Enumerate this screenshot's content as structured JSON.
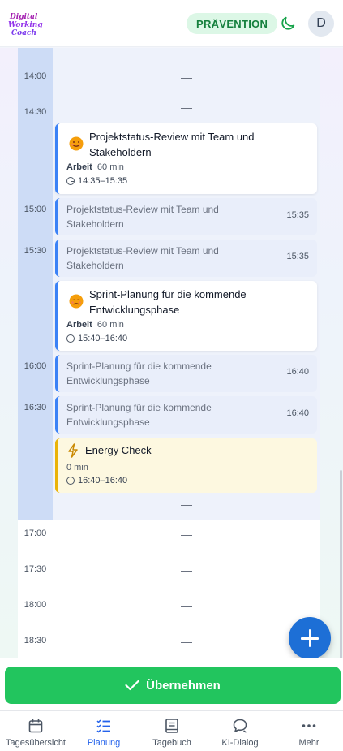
{
  "header": {
    "logo_text": "Digital Working Coach",
    "badge": "PRÄVENTION",
    "avatar_initial": "D",
    "colors": {
      "badge_bg": "#dcf7e6",
      "badge_text": "#15803d"
    }
  },
  "timeline": {
    "labels": [
      "14:00",
      "14:30",
      "15:00",
      "15:30",
      "16:00",
      "16:30",
      "17:00",
      "17:30",
      "18:00",
      "18:30"
    ],
    "events": [
      {
        "title": "Projektstatus-Review mit Team und Stakeholdern",
        "category": "Arbeit",
        "duration": "60 min",
        "time": "14:35–15:35",
        "mood": "happy-emoji"
      },
      {
        "title": "Sprint-Planung für die kommende Entwicklungsphase",
        "category": "Arbeit",
        "duration": "60 min",
        "time": "15:40–16:40",
        "mood": "sad-emoji"
      }
    ],
    "continuations": [
      {
        "text": "Projektstatus-Review mit Team und Stakeholdern",
        "end": "15:35"
      },
      {
        "text": "Projektstatus-Review mit Team und Stakeholdern",
        "end": "15:35"
      },
      {
        "text": "Sprint-Planung für die kommende Entwicklungsphase",
        "end": "16:40"
      },
      {
        "text": "Sprint-Planung für die kommende Entwicklungsphase",
        "end": "16:40"
      }
    ],
    "energy_check": {
      "title": "Energy Check",
      "duration": "0 min",
      "time": "16:40–16:40"
    }
  },
  "actions": {
    "apply_label": "Übernehmen",
    "add_icon": "plus-icon"
  },
  "nav": {
    "items": [
      {
        "label": "Tagesübersicht",
        "icon": "calendar-icon",
        "active": false
      },
      {
        "label": "Planung",
        "icon": "list-check-icon",
        "active": true
      },
      {
        "label": "Tagebuch",
        "icon": "book-icon",
        "active": false
      },
      {
        "label": "KI-Dialog",
        "icon": "chat-icon",
        "active": false
      },
      {
        "label": "Mehr",
        "icon": "more-icon",
        "active": false
      }
    ]
  },
  "colors": {
    "accent_blue": "#3b82f6",
    "apply_green": "#22c55e",
    "energy_yellow": "#eab308",
    "fab_blue": "#1d6fd6"
  }
}
